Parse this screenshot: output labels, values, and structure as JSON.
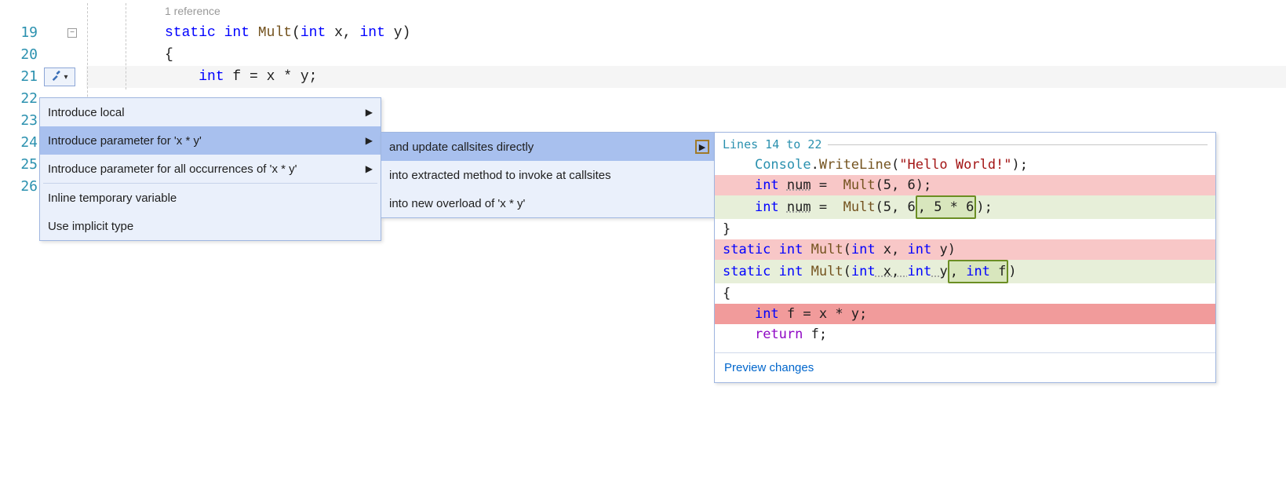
{
  "editor": {
    "lineNumbers": [
      "19",
      "20",
      "21",
      "22",
      "23",
      "24",
      "25",
      "26"
    ],
    "foldGlyph": "−",
    "codeLens": "1 reference",
    "line19": {
      "kw_static": "static",
      "kw_int": "int",
      "method": "Mult",
      "params_open": "(",
      "p1_type": "int",
      "p1_name": " x, ",
      "p2_type": "int",
      "p2_name": " y",
      "params_close": ")"
    },
    "line20": "{",
    "line21": {
      "indent": "    ",
      "kw_int": "int",
      "rest": " f = x * y;"
    }
  },
  "bulb": {
    "caret": "▾"
  },
  "menu1": {
    "items": [
      {
        "label": "Introduce local",
        "hasSub": true,
        "selected": false
      },
      {
        "label": "Introduce parameter for 'x * y'",
        "hasSub": true,
        "selected": true
      },
      {
        "label": "Introduce parameter for all occurrences of 'x * y'",
        "hasSub": true,
        "selected": false
      },
      {
        "sep": true
      },
      {
        "label": "Inline temporary variable",
        "hasSub": false,
        "selected": false
      },
      {
        "label": "Use implicit type",
        "hasSub": false,
        "selected": false
      }
    ],
    "arrow": "▶"
  },
  "menu2": {
    "items": [
      {
        "label": "and update callsites directly",
        "selected": true,
        "expand": true
      },
      {
        "label": "into extracted method to invoke at callsites",
        "selected": false,
        "expand": false
      },
      {
        "label": "into new overload of 'x * y'",
        "selected": false,
        "expand": false
      }
    ],
    "arrow": "▶"
  },
  "preview": {
    "header": "Lines 14 to 22",
    "lines": {
      "l1": {
        "indent": "    ",
        "cls": "Console",
        "dot": ".",
        "m": "WriteLine",
        "open": "(",
        "str": "\"Hello World!\"",
        "close": ");"
      },
      "l2": {
        "indent": "    ",
        "kw": "int",
        "sp": " ",
        "var": "num",
        "eq": " =  ",
        "m": "Mult",
        "args": "(5, 6);"
      },
      "l3": {
        "indent": "    ",
        "kw": "int",
        "sp": " ",
        "var": "num",
        "eq": " =  ",
        "m": "Mult",
        "open": "(5, 6",
        "ins": ", 5 * 6",
        "close": ");"
      },
      "l4": "",
      "l5": "}",
      "l6": "",
      "l7": {
        "kw_static": "static",
        "sp1": " ",
        "kw_int": "int",
        "sp2": " ",
        "m": "Mult",
        "params": "(",
        "t1": "int",
        "n1": " x, ",
        "t2": "int",
        "n2": " y",
        "close": ")"
      },
      "l8": {
        "kw_static": "static",
        "sp1": " ",
        "kw_int": "int",
        "sp2": " ",
        "m": "Mult",
        "params": "(",
        "t1": "int",
        "n1": " x, ",
        "t2": "int",
        "n2": " y",
        "ins": ", ",
        "t3": "int",
        "n3": " f",
        "close": ")"
      },
      "l9": "{",
      "l10": {
        "indent": "    ",
        "kw": "int",
        "rest": " f = x * y;"
      },
      "l11": {
        "indent": "    ",
        "ret": "return",
        "rest": " f;"
      }
    },
    "footer": "Preview changes"
  }
}
